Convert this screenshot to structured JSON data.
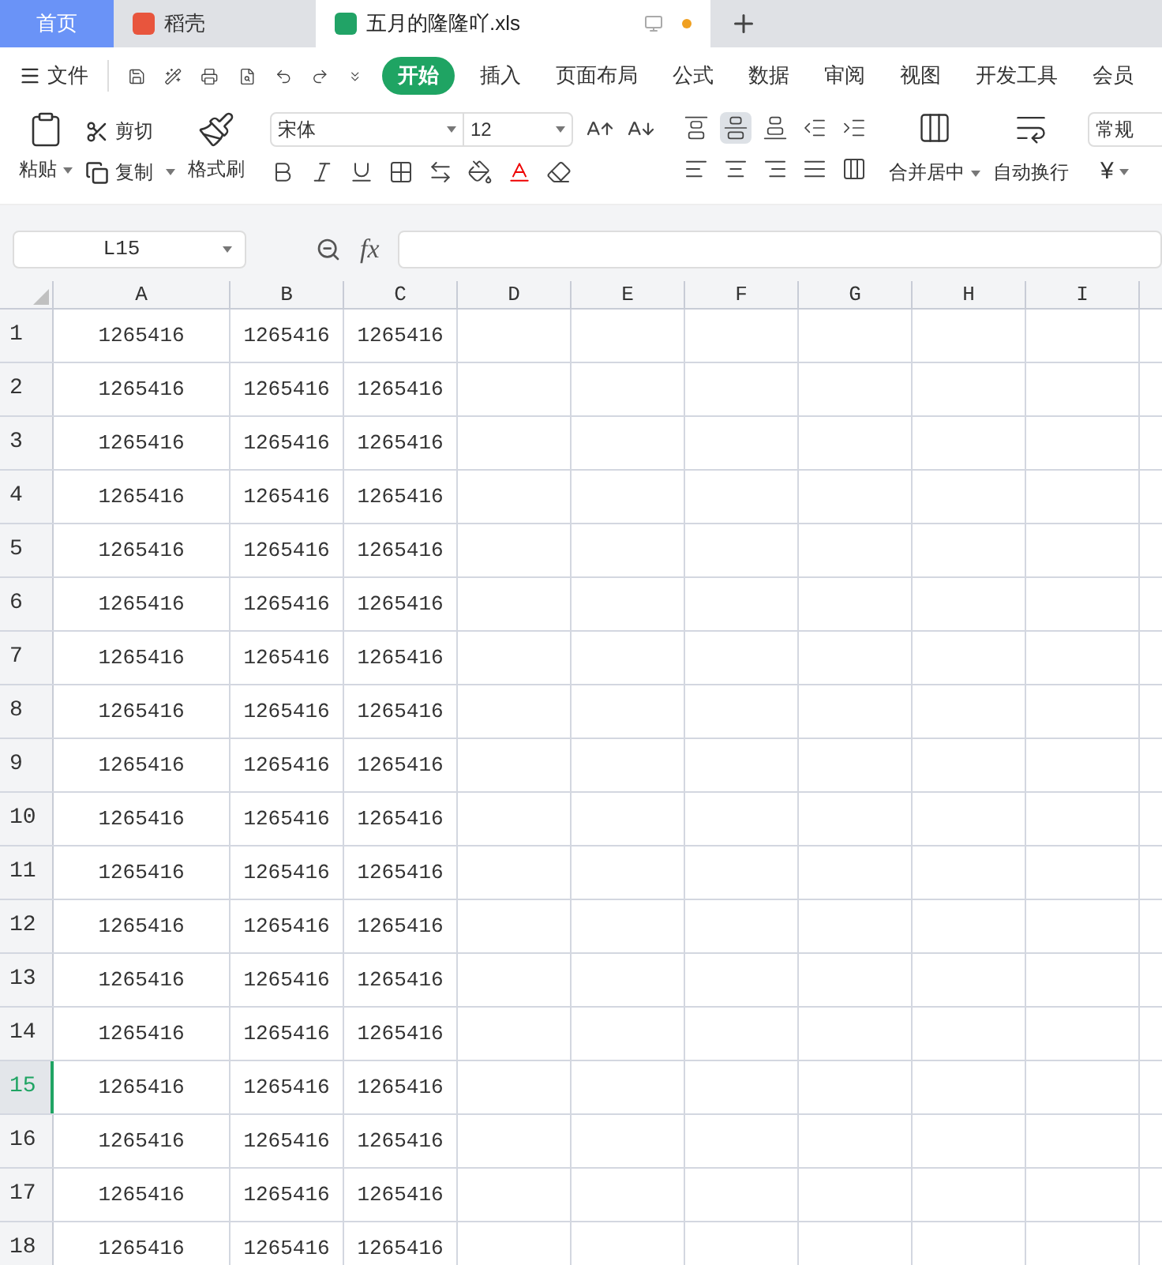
{
  "tabs": [
    {
      "label": "首页",
      "kind": "home",
      "selected": false
    },
    {
      "label": "稻壳",
      "kind": "docer",
      "selected": false
    },
    {
      "label": "五月的隆隆吖.xls",
      "kind": "sheet",
      "selected": true,
      "unsaved": true
    }
  ],
  "menu": {
    "file": "文件",
    "items": [
      {
        "label": "开始",
        "selected": true
      },
      {
        "label": "插入",
        "selected": false
      },
      {
        "label": "页面布局",
        "selected": false
      },
      {
        "label": "公式",
        "selected": false
      },
      {
        "label": "数据",
        "selected": false
      },
      {
        "label": "审阅",
        "selected": false
      },
      {
        "label": "视图",
        "selected": false
      },
      {
        "label": "开发工具",
        "selected": false
      },
      {
        "label": "会员",
        "selected": false
      }
    ]
  },
  "ribbon": {
    "paste": "粘贴",
    "cut": "剪切",
    "copy": "复制",
    "format_painter": "格式刷",
    "font": "宋体",
    "font_size": "12",
    "align_top": [
      {
        "selected": false
      },
      {
        "selected": true
      },
      {
        "selected": false
      },
      {
        "selected": false
      },
      {
        "selected": false
      }
    ],
    "merge": "合并居中",
    "wrap": "自动换行",
    "number_format": "常规",
    "currency": "¥"
  },
  "formula_bar": {
    "name_box": "L15",
    "function": "fx"
  },
  "columns": [
    "A",
    "B",
    "C",
    "D",
    "E",
    "F",
    "G",
    "H",
    "I"
  ],
  "rows": [
    {
      "header": "1",
      "cells": [
        "1265416",
        "1265416",
        "1265416"
      ],
      "selected": false
    },
    {
      "header": "2",
      "cells": [
        "1265416",
        "1265416",
        "1265416"
      ],
      "selected": false
    },
    {
      "header": "3",
      "cells": [
        "1265416",
        "1265416",
        "1265416"
      ],
      "selected": false
    },
    {
      "header": "4",
      "cells": [
        "1265416",
        "1265416",
        "1265416"
      ],
      "selected": false
    },
    {
      "header": "5",
      "cells": [
        "1265416",
        "1265416",
        "1265416"
      ],
      "selected": false
    },
    {
      "header": "6",
      "cells": [
        "1265416",
        "1265416",
        "1265416"
      ],
      "selected": false
    },
    {
      "header": "7",
      "cells": [
        "1265416",
        "1265416",
        "1265416"
      ],
      "selected": false
    },
    {
      "header": "8",
      "cells": [
        "1265416",
        "1265416",
        "1265416"
      ],
      "selected": false
    },
    {
      "header": "9",
      "cells": [
        "1265416",
        "1265416",
        "1265416"
      ],
      "selected": false
    },
    {
      "header": "10",
      "cells": [
        "1265416",
        "1265416",
        "1265416"
      ],
      "selected": false
    },
    {
      "header": "11",
      "cells": [
        "1265416",
        "1265416",
        "1265416"
      ],
      "selected": false
    },
    {
      "header": "12",
      "cells": [
        "1265416",
        "1265416",
        "1265416"
      ],
      "selected": false
    },
    {
      "header": "13",
      "cells": [
        "1265416",
        "1265416",
        "1265416"
      ],
      "selected": false
    },
    {
      "header": "14",
      "cells": [
        "1265416",
        "1265416",
        "1265416"
      ],
      "selected": false
    },
    {
      "header": "15",
      "cells": [
        "1265416",
        "1265416",
        "1265416"
      ],
      "selected": true
    },
    {
      "header": "16",
      "cells": [
        "1265416",
        "1265416",
        "1265416"
      ],
      "selected": false
    },
    {
      "header": "17",
      "cells": [
        "1265416",
        "1265416",
        "1265416"
      ],
      "selected": false
    },
    {
      "header": "18",
      "cells": [
        "1265416",
        "1265416",
        "1265416"
      ],
      "selected": false
    }
  ]
}
